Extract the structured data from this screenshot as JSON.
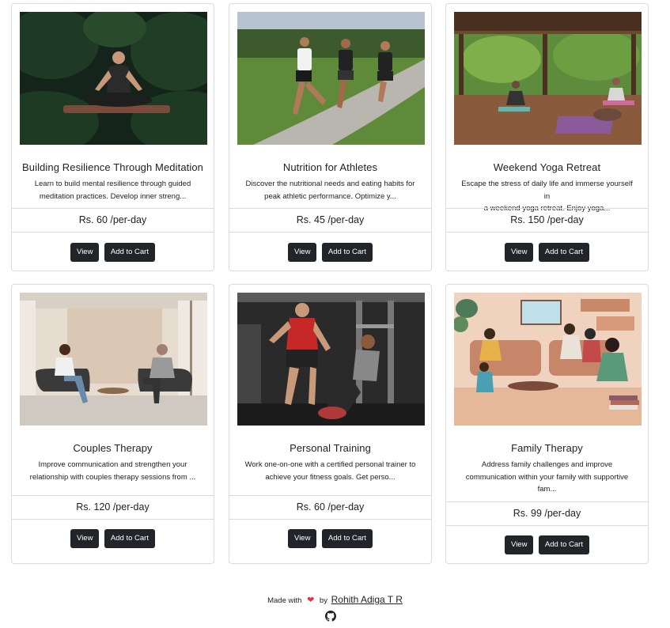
{
  "products": [
    {
      "title": "Building Resilience Through Meditation",
      "description_line1": "Learn to build mental resilience through guided",
      "description_line2": "meditation practices. Develop inner streng...",
      "description_line3": "",
      "price": "Rs. 60 /per-day",
      "view_label": "View",
      "cart_label": "Add to Cart"
    },
    {
      "title": "Nutrition for Athletes",
      "description_line1": "Discover the nutritional needs and eating habits for",
      "description_line2": "peak athletic performance. Optimize y...",
      "description_line3": "",
      "price": "Rs. 45 /per-day",
      "view_label": "View",
      "cart_label": "Add to Cart"
    },
    {
      "title": "Weekend Yoga Retreat",
      "description_line1": "Escape the stress of daily life and immerse yourself in",
      "description_line2": "a weekend yoga retreat. Enjoy yoga...",
      "description_line3": "",
      "price": "Rs. 150 /per-day",
      "view_label": "View",
      "cart_label": "Add to Cart"
    },
    {
      "title": "Couples Therapy",
      "description_line1": "Improve communication and strengthen your",
      "description_line2": "relationship with couples therapy sessions from ...",
      "description_line3": "",
      "price": "Rs. 120 /per-day",
      "view_label": "View",
      "cart_label": "Add to Cart"
    },
    {
      "title": "Personal Training",
      "description_line1": "Work one-on-one with a certified personal trainer to",
      "description_line2": "achieve your fitness goals. Get perso...",
      "description_line3": "",
      "price": "Rs. 60 /per-day",
      "view_label": "View",
      "cart_label": "Add to Cart"
    },
    {
      "title": "Family Therapy",
      "description_line1": "Address family challenges and improve",
      "description_line2": "communication within your family with supportive",
      "description_line3": "fam...",
      "price": "Rs. 99 /per-day",
      "view_label": "View",
      "cart_label": "Add to Cart"
    }
  ],
  "footer": {
    "made_with": "Made with",
    "by": "by",
    "author": "Rohith Adiga T R",
    "heart_icon": "heart-icon",
    "github_icon": "github-icon"
  },
  "colors": {
    "button_bg": "#212529",
    "heart": "#e8333b",
    "border": "#dcdcdc"
  }
}
